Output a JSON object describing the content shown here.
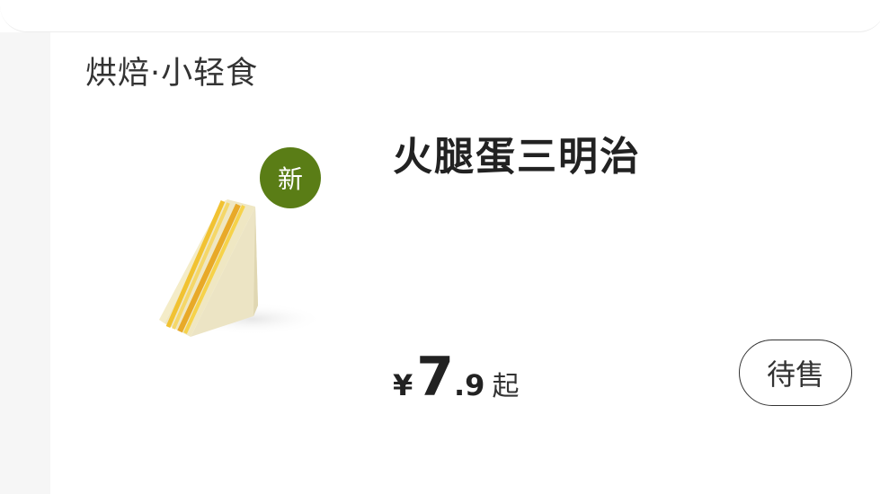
{
  "category": {
    "title": "烘焙·小轻食"
  },
  "product": {
    "name": "火腿蛋三明治",
    "badge": "新",
    "image_icon": "sandwich-icon",
    "price": {
      "currency": "¥",
      "integer": "7",
      "decimal": ".9",
      "suffix": "起"
    },
    "status_button_label": "待售"
  },
  "colors": {
    "badge_green": "#5a7d16",
    "rail_gray": "#f6f6f6",
    "text_dark": "#222222"
  }
}
